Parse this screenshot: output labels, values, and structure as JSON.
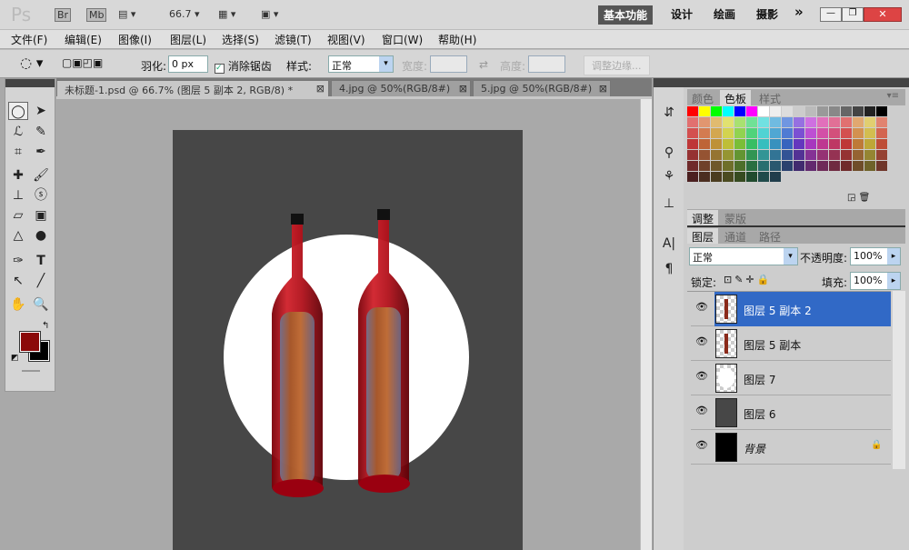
{
  "appbar": {
    "logo": "Ps",
    "br": "Br",
    "mb": "Mb",
    "zoom": "66.7",
    "workspaces": [
      "基本功能",
      "设计",
      "绘画",
      "摄影"
    ],
    "more": "»"
  },
  "menu": [
    "文件(F)",
    "编辑(E)",
    "图像(I)",
    "图层(L)",
    "选择(S)",
    "滤镜(T)",
    "视图(V)",
    "窗口(W)",
    "帮助(H)"
  ],
  "options": {
    "feather_label": "羽化:",
    "feather_value": "0 px",
    "antialias_label": "消除锯齿",
    "antialias_checked": true,
    "style_label": "样式:",
    "style_value": "正常",
    "width_label": "宽度:",
    "height_label": "高度:",
    "refine_label": "调整边缘..."
  },
  "tabs": [
    {
      "label": "未标题-1.psd @ 66.7% (图层 5 副本 2, RGB/8) *",
      "active": true
    },
    {
      "label": "4.jpg @ 50%(RGB/8#)"
    },
    {
      "label": "5.jpg @ 50%(RGB/8#)"
    }
  ],
  "colors": {
    "foreground": "#8b0a0a",
    "background": "#000000",
    "accent": "#3169c6"
  },
  "swatch_tabs": [
    "颜色",
    "色板",
    "样式"
  ],
  "adjust_tabs": [
    "调整",
    "蒙版"
  ],
  "layers_panel": {
    "tabs": [
      "图层",
      "通道",
      "路径"
    ],
    "blend": "正常",
    "opacity_label": "不透明度:",
    "opacity": "100%",
    "lock_label": "锁定:",
    "fill_label": "填充:",
    "fill": "100%",
    "layers": [
      {
        "name": "图层 5 副本 2",
        "selected": true,
        "thumb": "bottle"
      },
      {
        "name": "图层 5 副本",
        "thumb": "bottle"
      },
      {
        "name": "图层 7",
        "thumb": "white"
      },
      {
        "name": "图层 6",
        "thumb": "gray"
      },
      {
        "name": "背景",
        "thumb": "black",
        "locked": true
      }
    ]
  }
}
